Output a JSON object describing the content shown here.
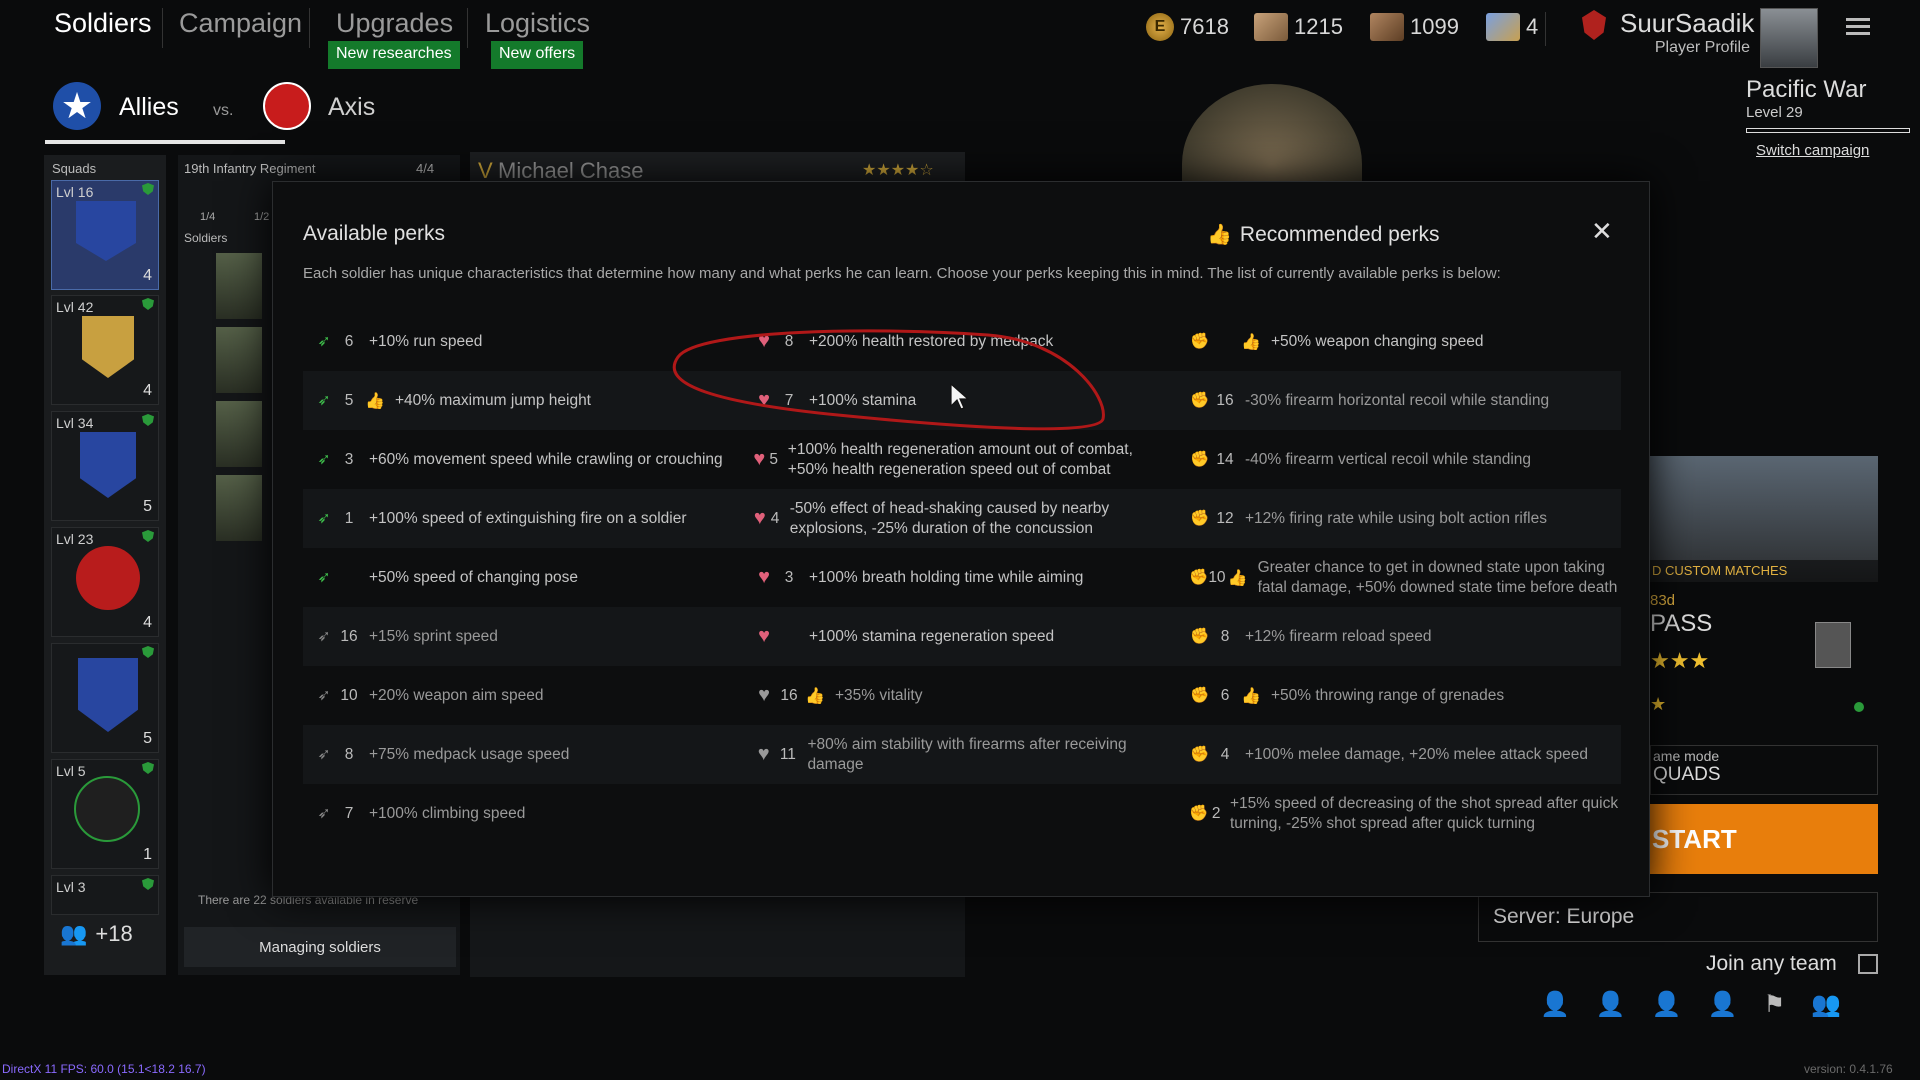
{
  "nav": {
    "tabs": [
      "Soldiers",
      "Campaign",
      "Upgrades",
      "Logistics"
    ],
    "badges": {
      "upgrades": "New researches",
      "logistics": "New offers"
    }
  },
  "resources": {
    "gold": "7618",
    "silver_tickets": "1215",
    "bronze_tickets": "1099",
    "premium_cards": "4"
  },
  "profile": {
    "name": "SuurSaadik",
    "subtitle": "Player Profile"
  },
  "campaign": {
    "name": "Pacific War",
    "level": "Level 29",
    "switch": "Switch campaign"
  },
  "factions": {
    "allies": "Allies",
    "vs": "vs.",
    "axis": "Axis"
  },
  "squads": {
    "title": "Squads",
    "items": [
      {
        "lvl": "Lvl 16",
        "count": "4"
      },
      {
        "lvl": "Lvl 42",
        "count": "4"
      },
      {
        "lvl": "Lvl 34",
        "count": "5"
      },
      {
        "lvl": "Lvl 23",
        "count": "4"
      },
      {
        "lvl": "",
        "count": "5"
      },
      {
        "lvl": "Lvl 5",
        "count": "1"
      },
      {
        "lvl": "Lvl 3",
        "count": ""
      }
    ],
    "reserve_extra": "+18"
  },
  "regiment": {
    "name": "19th Infantry Regiment",
    "capacity": "4/4",
    "soldiers_label": "Soldiers",
    "slot_a": "1/4",
    "slot_b": "1/2",
    "reserve_note": "There are 22 soldiers available in reserve",
    "manage": "Managing soldiers"
  },
  "soldier": {
    "name": "Michael Chase",
    "rank_mark": "V"
  },
  "modal": {
    "title": "Available perks",
    "recommended": "Recommended perks",
    "description": "Each soldier has unique characteristics that determine how many and what perks he can learn. Choose your perks keeping this in mind. The list of currently available perks is below:",
    "columns": [
      [
        {
          "num": "6",
          "text": "+10% run speed",
          "rec": false,
          "avail": true
        },
        {
          "num": "5",
          "text": "+40% maximum jump height",
          "rec": true,
          "avail": true
        },
        {
          "num": "3",
          "text": "+60% movement speed while crawling or crouching",
          "rec": false,
          "avail": true
        },
        {
          "num": "1",
          "text": "+100% speed of extinguishing fire on a soldier",
          "rec": false,
          "avail": true
        },
        {
          "num": "",
          "text": "+50% speed of changing pose",
          "rec": false,
          "avail": true
        },
        {
          "num": "16",
          "text": "+15% sprint speed",
          "rec": false,
          "avail": false
        },
        {
          "num": "10",
          "text": "+20% weapon aim speed",
          "rec": false,
          "avail": false
        },
        {
          "num": "8",
          "text": "+75% medpack usage speed",
          "rec": false,
          "avail": false
        },
        {
          "num": "7",
          "text": "+100% climbing speed",
          "rec": false,
          "avail": false
        }
      ],
      [
        {
          "num": "8",
          "text": "+200% health restored by medpack",
          "rec": false,
          "avail": true
        },
        {
          "num": "7",
          "text": "+100% stamina",
          "rec": false,
          "avail": true
        },
        {
          "num": "5",
          "text": "+100% health regeneration amount out of combat, +50% health regeneration speed out of combat",
          "rec": false,
          "avail": true
        },
        {
          "num": "4",
          "text": "-50% effect of head-shaking caused by nearby explosions, -25% duration of the concussion",
          "rec": false,
          "avail": true
        },
        {
          "num": "3",
          "text": "+100% breath holding time while aiming",
          "rec": false,
          "avail": true
        },
        {
          "num": "",
          "text": "+100% stamina regeneration speed",
          "rec": false,
          "avail": true
        },
        {
          "num": "16",
          "text": "+35% vitality",
          "rec": true,
          "avail": false
        },
        {
          "num": "11",
          "text": "+80% aim stability with firearms after receiving damage",
          "rec": false,
          "avail": false
        }
      ],
      [
        {
          "num": "",
          "text": "+50% weapon changing speed",
          "rec": true,
          "avail": true
        },
        {
          "num": "16",
          "text": "-30% firearm horizontal recoil while standing",
          "rec": false,
          "avail": false
        },
        {
          "num": "14",
          "text": "-40% firearm vertical recoil while standing",
          "rec": false,
          "avail": false
        },
        {
          "num": "12",
          "text": "+12% firing rate while using bolt action rifles",
          "rec": false,
          "avail": false
        },
        {
          "num": "10",
          "text": "Greater chance to get in downed state upon taking fatal damage, +50% downed state time before death",
          "rec": true,
          "avail": false
        },
        {
          "num": "8",
          "text": "+12% firearm reload speed",
          "rec": false,
          "avail": false
        },
        {
          "num": "6",
          "text": "+50% throwing range of grenades",
          "rec": true,
          "avail": false
        },
        {
          "num": "4",
          "text": "+100% melee damage, +20% melee attack speed",
          "rec": false,
          "avail": false
        },
        {
          "num": "2",
          "text": "+15% speed of decreasing of the shot spread after quick turning, -25% shot spread after quick turning",
          "rec": false,
          "avail": false
        }
      ]
    ]
  },
  "right": {
    "custom_matches": "D CUSTOM MATCHES",
    "sub": "83d",
    "pass": "PASS",
    "mode_label": "ame mode",
    "mode_value": "QUADS",
    "start": "START",
    "server": "Server: Europe",
    "join_any": "Join any team"
  },
  "footer": {
    "fps": "DirectX 11 FPS: 60.0 (15.1<18.2 16.7)",
    "version": "version: 0.4.1.76"
  },
  "colors": {
    "green": "#147a2b",
    "orange": "#e87e0c",
    "allies_blue": "#1f4fa8",
    "axis_red": "#c81c1c",
    "heart": "#e0607a",
    "perk_green": "#3fbf4c"
  }
}
